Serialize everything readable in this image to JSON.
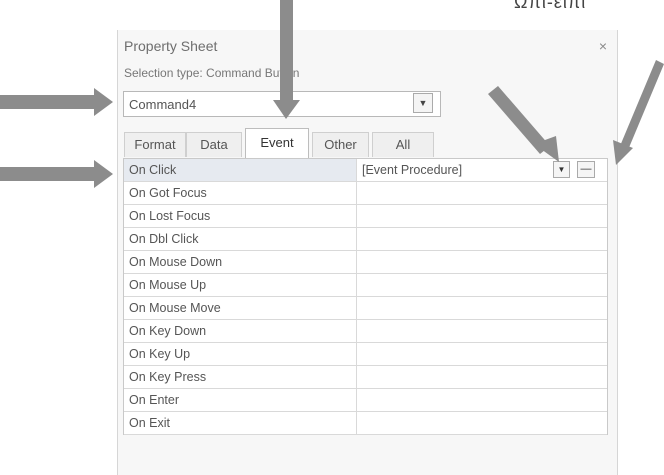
{
  "corner_text": "Ωπι-ειπι",
  "panel": {
    "title": "Property Sheet",
    "close": "×",
    "selection_type": "Selection type: Command Button",
    "object_combo": {
      "value": "Command4",
      "button": "▼"
    }
  },
  "tabs": [
    {
      "label": "Format"
    },
    {
      "label": "Data"
    },
    {
      "label": "Event"
    },
    {
      "label": "Other"
    },
    {
      "label": "All"
    }
  ],
  "active_tab": "Event",
  "properties": [
    {
      "name": "On Click",
      "value": "[Event Procedure]"
    },
    {
      "name": "On Got Focus",
      "value": ""
    },
    {
      "name": "On Lost Focus",
      "value": ""
    },
    {
      "name": "On Dbl Click",
      "value": ""
    },
    {
      "name": "On Mouse Down",
      "value": ""
    },
    {
      "name": "On Mouse Up",
      "value": ""
    },
    {
      "name": "On Mouse Move",
      "value": ""
    },
    {
      "name": "On Key Down",
      "value": ""
    },
    {
      "name": "On Key Up",
      "value": ""
    },
    {
      "name": "On Key Press",
      "value": ""
    },
    {
      "name": "On Enter",
      "value": ""
    },
    {
      "name": "On Exit",
      "value": ""
    }
  ],
  "row_buttons": {
    "dropdown": "▼",
    "build": "—"
  },
  "colors": {
    "arrow": "#8c8c8c",
    "selected_row": "#e6eaf0"
  }
}
